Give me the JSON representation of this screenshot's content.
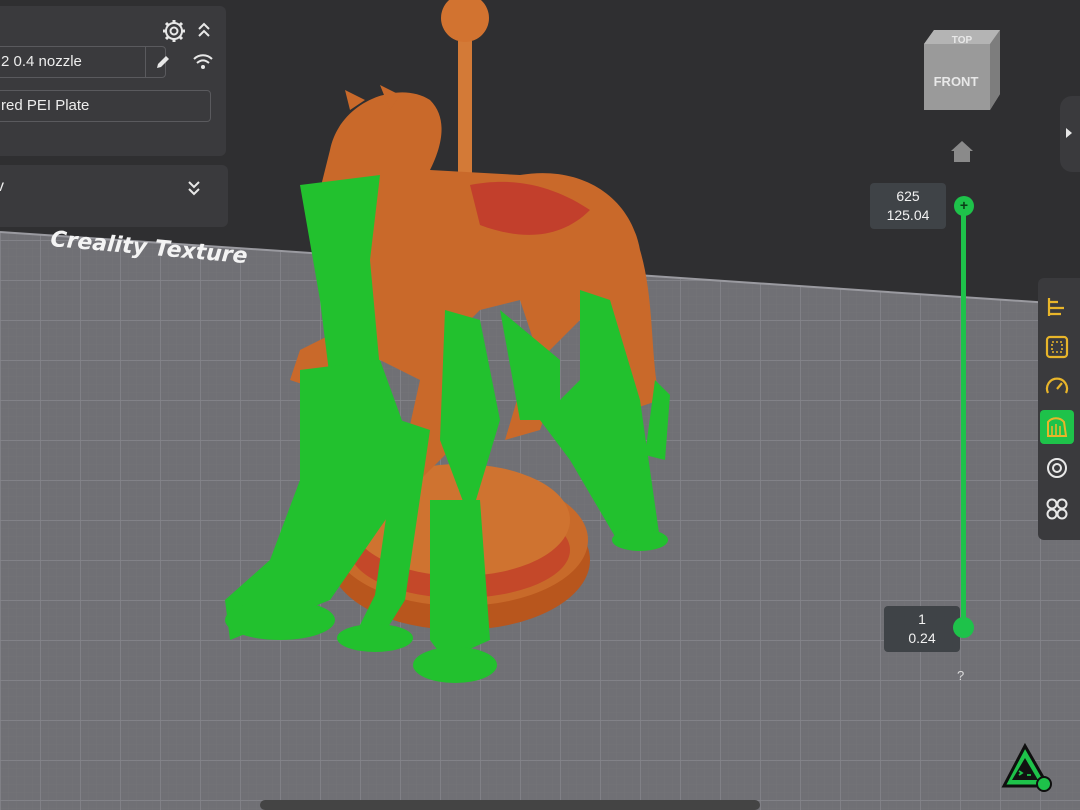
{
  "printer": {
    "nozzle": "2 0.4 nozzle",
    "plate": "red PEI Plate"
  },
  "view_panel": {
    "label": "v"
  },
  "bed": {
    "label": "Creality Texture"
  },
  "nav_cube": {
    "top": "TOP",
    "front": "FRONT"
  },
  "layer_slider": {
    "top_layer": "625",
    "top_height": "125.04",
    "bottom_layer": "1",
    "bottom_height": "0.24",
    "top_handle_glyph": "+",
    "help": "?"
  },
  "toolbar": {
    "tools": [
      {
        "name": "layers-align-icon",
        "active": false
      },
      {
        "name": "select-box-icon",
        "active": false
      },
      {
        "name": "speedometer-icon",
        "active": false
      },
      {
        "name": "support-paint-icon",
        "active": true
      },
      {
        "name": "target-icon",
        "active": false
      },
      {
        "name": "cloverleaf-icon",
        "active": false
      }
    ]
  },
  "colors": {
    "accent": "#1ec24a",
    "model": "#c86a2a",
    "support": "#22c12e",
    "bed": "#6d6d72",
    "panel": "#3a3a3d"
  }
}
